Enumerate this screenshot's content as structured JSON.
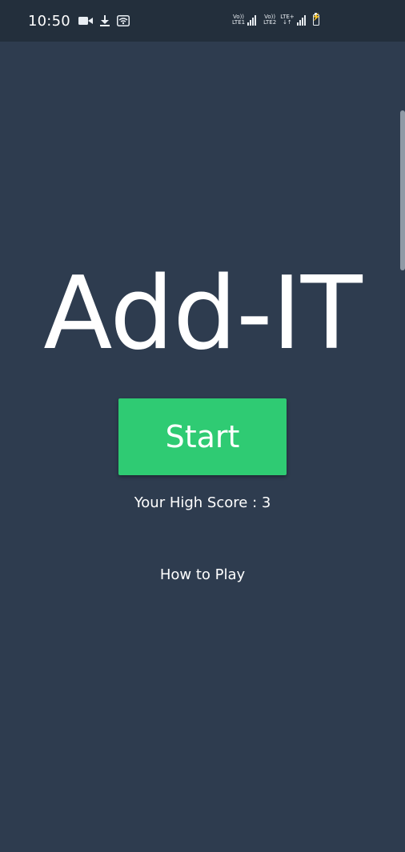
{
  "status_bar": {
    "time": "10:50",
    "left_icons": [
      "video-camera-icon",
      "download-icon",
      "wifi-icon"
    ],
    "sim1_label_top": "Vo))",
    "sim1_label_bottom": "LTE1",
    "sim2_label_top": "Vo))",
    "sim2_label_bottom": "LTE2",
    "data_label": "LTE+",
    "battery": "battery-charging-icon"
  },
  "app": {
    "title": "Add-IT",
    "start_label": "Start",
    "high_score_text": "Your High Score : 3",
    "how_to_play_label": "How to Play"
  },
  "colors": {
    "background": "#2e3c4f",
    "status_bar": "#232f3c",
    "start_button": "#2fcb73",
    "text": "#ffffff"
  }
}
